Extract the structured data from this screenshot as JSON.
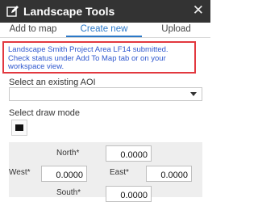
{
  "window": {
    "title": "Landscape Tools",
    "close_glyph": "✕",
    "icon": "pencil-edit-icon"
  },
  "tabs": [
    {
      "label": "Add to map"
    },
    {
      "label": "Create new",
      "active": true
    },
    {
      "label": "Upload"
    }
  ],
  "message": "Landscape Smith Project Area LF14 submitted. Check status under Add To Map tab or on your workspace view.",
  "aoi": {
    "label": "Select an existing AOI",
    "selected": ""
  },
  "draw": {
    "label": "Select draw mode",
    "icon": "rectangle-draw-icon"
  },
  "coordinates": {
    "north_label": "North*",
    "north_value": "0.0000",
    "west_label": "West*",
    "west_value": "0.0000",
    "east_label": "East*",
    "east_value": "0.0000",
    "south_label": "South*",
    "south_value": "0.0000"
  },
  "colors": {
    "titlebar": "#333333",
    "accent": "#2a78c8",
    "message_text": "#2f58cf",
    "message_border": "#e2383f"
  }
}
